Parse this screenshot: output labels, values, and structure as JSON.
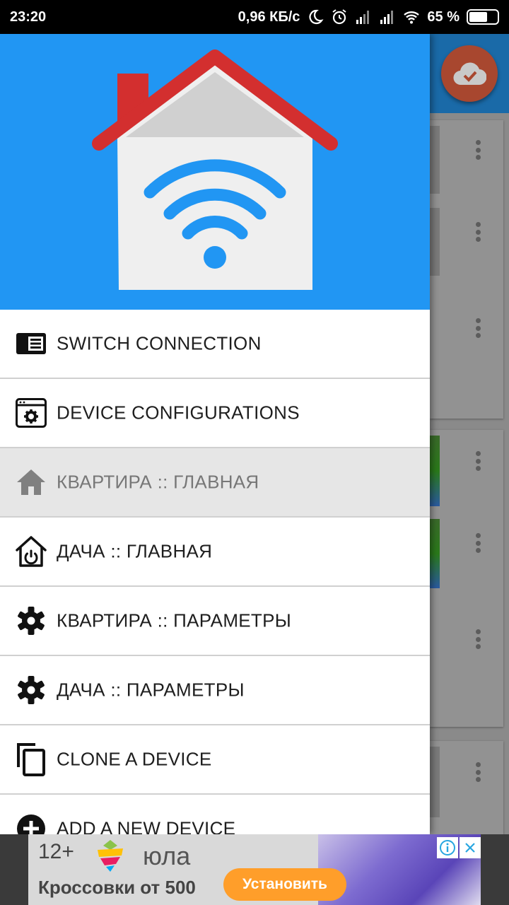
{
  "status_bar": {
    "time": "23:20",
    "net_speed": "0,96 КБ/с",
    "battery_percent": "65 %",
    "battery_level": 0.65
  },
  "drawer": {
    "items": [
      {
        "label": "SWITCH CONNECTION",
        "icon": "switch-connection-icon",
        "active": false
      },
      {
        "label": "DEVICE CONFIGURATIONS",
        "icon": "device-config-icon",
        "active": false
      },
      {
        "label": "КВАРТИРА :: ГЛАВНАЯ",
        "icon": "home-icon",
        "active": true
      },
      {
        "label": "ДАЧА :: ГЛАВНАЯ",
        "icon": "home-power-icon",
        "active": false
      },
      {
        "label": "КВАРТИРА :: ПАРАМЕТРЫ",
        "icon": "gear-icon",
        "active": false
      },
      {
        "label": "ДАЧА :: ПАРАМЕТРЫ",
        "icon": "gear-icon",
        "active": false
      },
      {
        "label": "CLONE A DEVICE",
        "icon": "copy-icon",
        "active": false
      },
      {
        "label": "ADD A NEW DEVICE",
        "icon": "add-circle-icon",
        "active": false
      }
    ]
  },
  "ad": {
    "age_rating": "12+",
    "brand": "юла",
    "text": "Кроссовки от 500",
    "cta": "Установить"
  },
  "colors": {
    "header_blue": "#2196f3",
    "roof_red": "#d32f2f",
    "fab": "#a8472f",
    "ad_cta": "#ff9e2a"
  }
}
